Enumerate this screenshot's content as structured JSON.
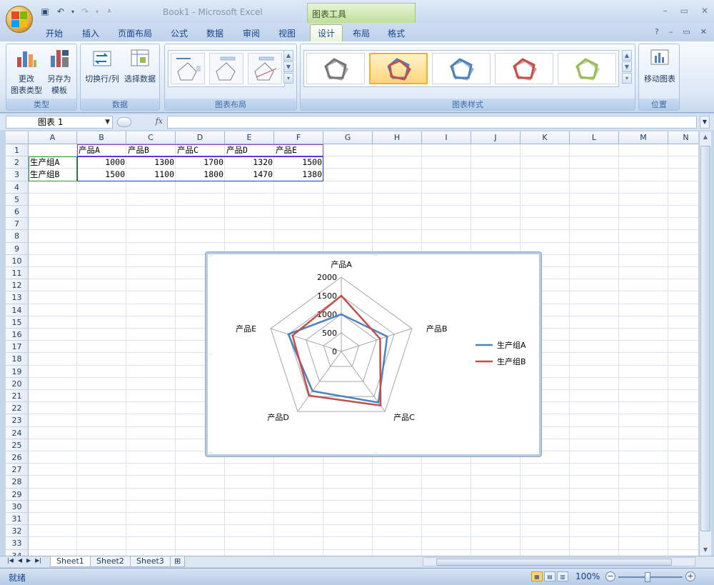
{
  "window": {
    "title": "Book1 - Microsoft Excel",
    "tools_tab": "图表工具"
  },
  "qat": [
    "save-icon",
    "undo-icon",
    "redo-icon",
    "customize-icon"
  ],
  "window_controls": [
    "–",
    "▭",
    "✕"
  ],
  "ribbon_tabs": [
    "开始",
    "插入",
    "页面布局",
    "公式",
    "数据",
    "审阅",
    "视图",
    "设计",
    "布局",
    "格式"
  ],
  "active_tab": "设计",
  "ribbon_groups": {
    "type": {
      "label": "类型",
      "change_type_l1": "更改",
      "change_type_l2": "图表类型",
      "save_template_l1": "另存为",
      "save_template_l2": "模板"
    },
    "data": {
      "label": "数据",
      "switch": "切换行/列",
      "select": "选择数据"
    },
    "layout": {
      "label": "图表布局"
    },
    "styles": {
      "label": "图表样式",
      "colors": [
        "#777777",
        "#c0504d",
        "#4f81bd",
        "#c0504d",
        "#9bbb59"
      ]
    },
    "location": {
      "label": "位置",
      "move": "移动图表"
    }
  },
  "namebox": "图表 1",
  "fx": "fx",
  "columns": [
    "A",
    "B",
    "C",
    "D",
    "E",
    "F",
    "G",
    "H",
    "I",
    "J",
    "K",
    "L",
    "M",
    "N"
  ],
  "rows": [
    "1",
    "2",
    "3",
    "4",
    "5",
    "6",
    "7",
    "8",
    "9",
    "10",
    "11",
    "12",
    "13",
    "14",
    "15",
    "16",
    "17",
    "18",
    "19",
    "20",
    "21",
    "22",
    "23",
    "24",
    "25",
    "26",
    "27",
    "28",
    "29",
    "30",
    "31",
    "32",
    "33",
    "34"
  ],
  "cells": {
    "headers": [
      "产品A",
      "产品B",
      "产品C",
      "产品D",
      "产品E"
    ],
    "row2": {
      "label": "生产组A",
      "values": [
        "1000",
        "1300",
        "1700",
        "1320",
        "1500"
      ]
    },
    "row3": {
      "label": "生产组B",
      "values": [
        "1500",
        "1100",
        "1800",
        "1470",
        "1380"
      ]
    }
  },
  "chart_data": {
    "type": "radar",
    "categories": [
      "产品A",
      "产品B",
      "产品C",
      "产品D",
      "产品E"
    ],
    "series": [
      {
        "name": "生产组A",
        "values": [
          1000,
          1300,
          1700,
          1320,
          1500
        ],
        "color": "#4f81bd"
      },
      {
        "name": "生产组B",
        "values": [
          1500,
          1100,
          1800,
          1470,
          1380
        ],
        "color": "#c0504d"
      }
    ],
    "axis_ticks": [
      "0",
      "500",
      "1000",
      "1500",
      "2000"
    ],
    "rmax": 2000,
    "legend": "right"
  },
  "sheets": [
    "Sheet1",
    "Sheet2",
    "Sheet3"
  ],
  "active_sheet": "Sheet1",
  "status": {
    "text": "就绪",
    "zoom": "100%"
  },
  "colors": {
    "accent": "#c5d5ea",
    "tools_green": "#bfe09a"
  }
}
